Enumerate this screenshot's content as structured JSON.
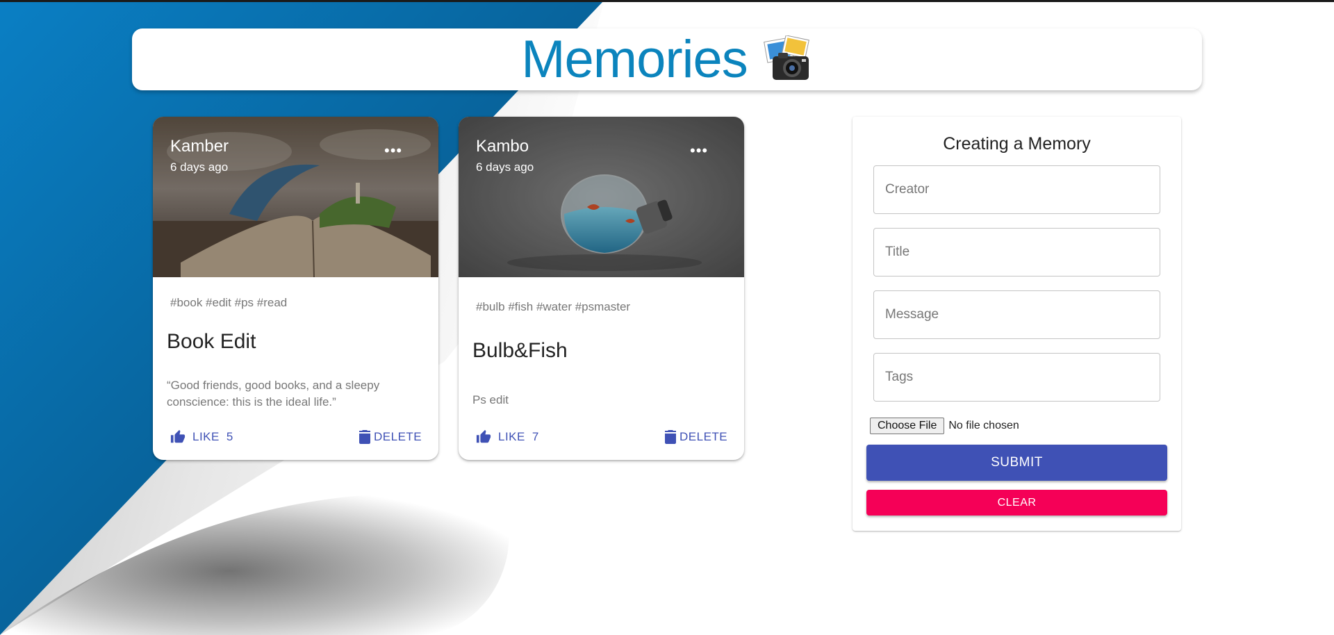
{
  "app": {
    "title": "Memories"
  },
  "colors": {
    "brand": "#0b84bd",
    "primary": "#3f51b5",
    "secondary": "#f50057"
  },
  "posts": [
    {
      "creator": "Kamber",
      "time": "6 days ago",
      "tags": "#book #edit #ps #read",
      "title": "Book Edit",
      "message": "“Good friends, good books, and a sleepy conscience: this is the ideal life.”",
      "like_label": "LIKE",
      "like_count": "5",
      "delete_label": "DELETE",
      "more_icon": "more-horiz-icon"
    },
    {
      "creator": "Kambo",
      "time": "6 days ago",
      "tags": "#bulb #fish #water #psmaster",
      "title": "Bulb&Fish",
      "message": "Ps edit",
      "like_label": "LIKE",
      "like_count": "7",
      "delete_label": "DELETE",
      "more_icon": "more-horiz-icon"
    }
  ],
  "form": {
    "title": "Creating a Memory",
    "creator_placeholder": "Creator",
    "title_placeholder": "Title",
    "message_placeholder": "Message",
    "tags_placeholder": "Tags",
    "file_button": "Choose File",
    "file_status": "No file chosen",
    "submit_label": "SUBMIT",
    "clear_label": "CLEAR"
  }
}
